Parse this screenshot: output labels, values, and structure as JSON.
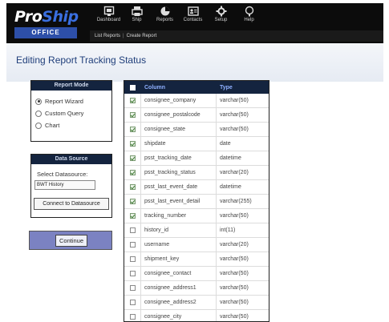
{
  "brand": {
    "name_part1": "Pro",
    "name_part2": "Ship",
    "sub": "OFFICE"
  },
  "nav": [
    {
      "label": "Dashboard",
      "icon": "dashboard-icon"
    },
    {
      "label": "Ship",
      "icon": "printer-icon"
    },
    {
      "label": "Reports",
      "icon": "pie-chart-icon"
    },
    {
      "label": "Contacts",
      "icon": "contact-card-icon"
    },
    {
      "label": "Setup",
      "icon": "gear-icon"
    },
    {
      "label": "Help",
      "icon": "help-icon"
    }
  ],
  "subnav": {
    "list_reports": "List Reports",
    "separator": "|",
    "create_report": "Create Report"
  },
  "page": {
    "title": "Editing Report Tracking Status"
  },
  "report_mode": {
    "title": "Report Mode",
    "options": [
      {
        "label": "Report Wizard",
        "selected": true
      },
      {
        "label": "Custom Query",
        "selected": false
      },
      {
        "label": "Chart",
        "selected": false
      }
    ]
  },
  "data_source": {
    "title": "Data Source",
    "select_label": "Select Datasource:",
    "selected_value": "BWT History",
    "connect_button": "Connect to Datasource"
  },
  "continue_button": "Continue",
  "columns_table": {
    "headers": {
      "column": "Column",
      "type": "Type"
    },
    "rows": [
      {
        "column": "consignee_company",
        "type": "varchar(50)",
        "checked": true
      },
      {
        "column": "consignee_postalcode",
        "type": "varchar(50)",
        "checked": true
      },
      {
        "column": "consignee_state",
        "type": "varchar(50)",
        "checked": true
      },
      {
        "column": "shipdate",
        "type": "date",
        "checked": true
      },
      {
        "column": "psst_tracking_date",
        "type": "datetime",
        "checked": true
      },
      {
        "column": "psst_tracking_status",
        "type": "varchar(20)",
        "checked": true
      },
      {
        "column": "psst_last_event_date",
        "type": "datetime",
        "checked": true
      },
      {
        "column": "psst_last_event_detail",
        "type": "varchar(255)",
        "checked": true
      },
      {
        "column": "tracking_number",
        "type": "varchar(50)",
        "checked": true
      },
      {
        "column": "history_id",
        "type": "int(11)",
        "checked": false
      },
      {
        "column": "username",
        "type": "varchar(20)",
        "checked": false
      },
      {
        "column": "shipment_key",
        "type": "varchar(50)",
        "checked": false
      },
      {
        "column": "consignee_contact",
        "type": "varchar(50)",
        "checked": false
      },
      {
        "column": "consignee_address1",
        "type": "varchar(50)",
        "checked": false
      },
      {
        "column": "consignee_address2",
        "type": "varchar(50)",
        "checked": false
      },
      {
        "column": "consignee_city",
        "type": "varchar(50)",
        "checked": false
      }
    ]
  }
}
